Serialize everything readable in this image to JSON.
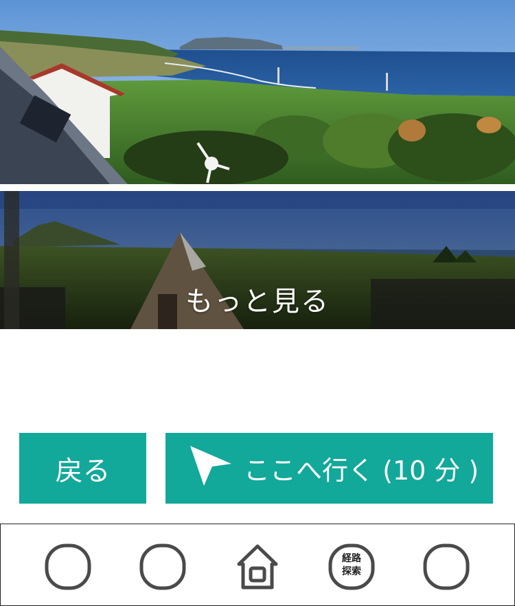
{
  "gallery": {
    "more_label": "もっと見る"
  },
  "actions": {
    "back_label": "戻る",
    "go_label": "ここへ行く (10 分 )"
  },
  "tabbar": {
    "route_search_label": "経路\n探索"
  },
  "colors": {
    "accent": "#12a89a",
    "tab_icon_stroke": "#4a4a4a"
  },
  "icons": {
    "navigate": "navigation-arrow-icon",
    "home": "home-icon",
    "placeholder": "circle-tab-icon"
  }
}
